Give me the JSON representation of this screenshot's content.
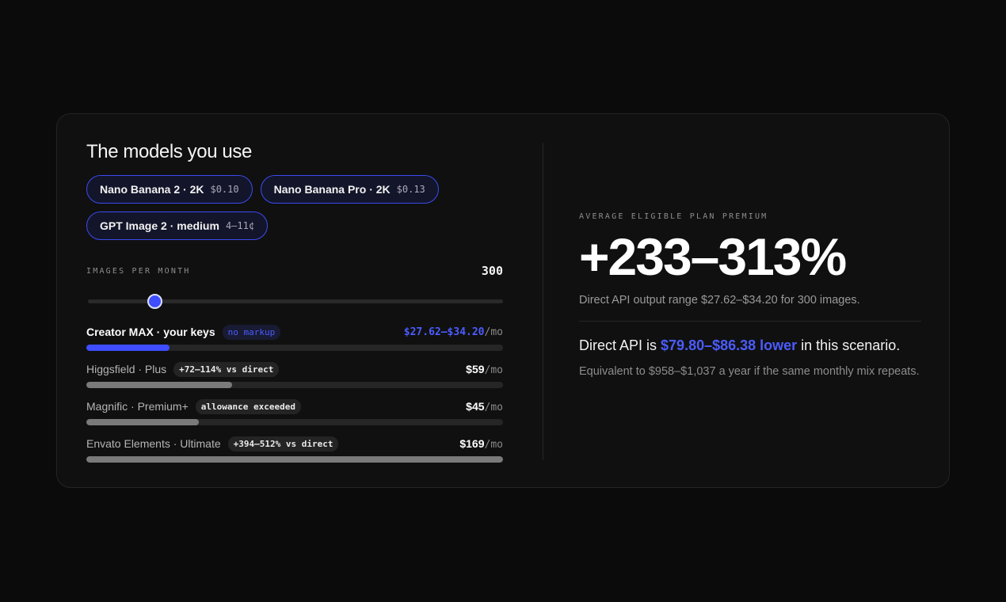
{
  "title": "The models you use",
  "models": [
    {
      "name": "Nano Banana 2 · 2K",
      "price": "$0.10",
      "selected": true
    },
    {
      "name": "Nano Banana Pro · 2K",
      "price": "$0.13",
      "selected": true
    },
    {
      "name": "GPT Image 2 · medium",
      "price": "4–11¢",
      "selected": true
    }
  ],
  "slider": {
    "label": "IMAGES PER MONTH",
    "value": 300,
    "value_text": "300",
    "fraction": 0.16
  },
  "plans": [
    {
      "name": "Creator MAX · your keys",
      "tag": "no markup",
      "price": "$27.62–$34.20",
      "unit": "/mo",
      "fill": 0.2
    },
    {
      "name": "Higgsfield · Plus",
      "tag": "+72–114% vs direct",
      "price": "$59",
      "unit": "/mo",
      "fill": 0.35
    },
    {
      "name": "Magnific · Premium+",
      "tag": "allowance exceeded",
      "price": "$45",
      "unit": "/mo",
      "fill": 0.27
    },
    {
      "name": "Envato Elements · Ultimate",
      "tag": "+394–512% vs direct",
      "price": "$169",
      "unit": "/mo",
      "fill": 1.0
    }
  ],
  "summary": {
    "label": "AVERAGE ELIGIBLE PLAN PREMIUM",
    "value": "+233–313%",
    "range_text": "Direct API output range $27.62–$34.20 for 300 images.",
    "savings_prefix": "Direct API is ",
    "savings_highlight": "$79.80–$86.38 lower",
    "savings_suffix": " in this scenario.",
    "equivalent": "Equivalent to $958–$1,037 a year if the same monthly mix repeats."
  },
  "colors": {
    "accent": "#3d4dff",
    "accent_text": "#4b5cff"
  }
}
